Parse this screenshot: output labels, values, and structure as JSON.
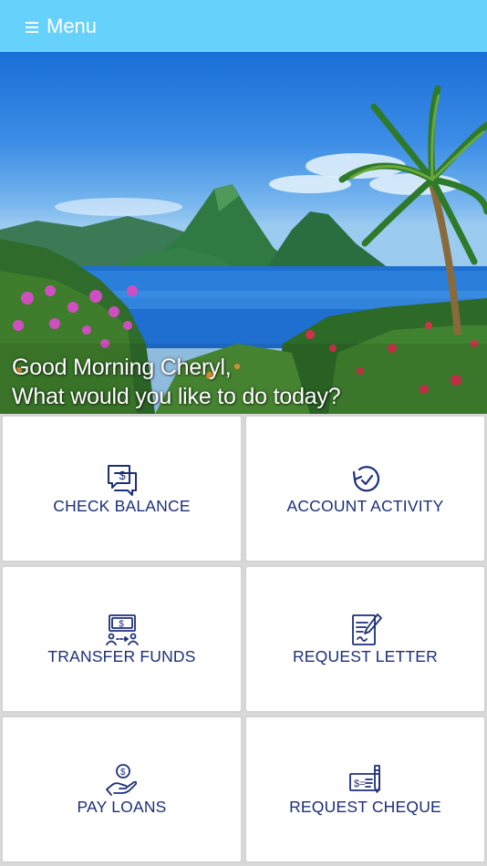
{
  "header": {
    "menu_label": "Menu",
    "menu_icon": "hamburger-menu-icon",
    "background_color": "#66d2fb"
  },
  "hero": {
    "greeting_line1": "Good Morning Cheryl,",
    "greeting_line2": "What would you like to do today?"
  },
  "actions": [
    {
      "label": "CHECK BALANCE",
      "icon": "check-balance-icon"
    },
    {
      "label": "ACCOUNT ACTIVITY",
      "icon": "account-activity-icon"
    },
    {
      "label": "TRANSFER FUNDS",
      "icon": "transfer-funds-icon"
    },
    {
      "label": "REQUEST LETTER",
      "icon": "request-letter-icon"
    },
    {
      "label": "PAY LOANS",
      "icon": "pay-loans-icon"
    },
    {
      "label": "REQUEST CHEQUE",
      "icon": "request-cheque-icon"
    }
  ],
  "colors": {
    "label_text": "#1c2f7a",
    "icon_stroke": "#1c2f7a",
    "tile_background": "#ffffff",
    "tile_border": "#d4d4d4"
  }
}
